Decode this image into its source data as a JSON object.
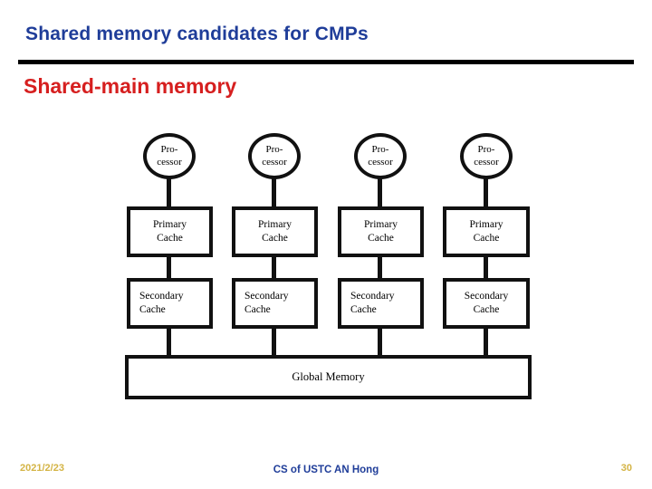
{
  "slide": {
    "title": "Shared memory candidates for CMPs",
    "subtitle": "Shared-main memory",
    "rule_color": "#000000",
    "title_color": "#1f3d99",
    "subtitle_color": "#d61f1f",
    "background": "#ffffff"
  },
  "diagram": {
    "type": "block-diagram",
    "line_color": "#111111",
    "columns": [
      {
        "processor": {
          "line1": "Pro-",
          "line2": "cessor"
        },
        "primary_cache": {
          "line1": "Primary",
          "line2": "Cache",
          "align": "center"
        },
        "secondary_cache": {
          "line1": "Secondary",
          "line2": "Cache",
          "align": "left"
        }
      },
      {
        "processor": {
          "line1": "Pro-",
          "line2": "cessor"
        },
        "primary_cache": {
          "line1": "Primary",
          "line2": "Cache",
          "align": "center"
        },
        "secondary_cache": {
          "line1": "Secondary",
          "line2": "Cache",
          "align": "left"
        }
      },
      {
        "processor": {
          "line1": "Pro-",
          "line2": "cessor"
        },
        "primary_cache": {
          "line1": "Primary",
          "line2": "Cache",
          "align": "center"
        },
        "secondary_cache": {
          "line1": "Secondary",
          "line2": "Cache",
          "align": "left"
        }
      },
      {
        "processor": {
          "line1": "Pro-",
          "line2": "cessor"
        },
        "primary_cache": {
          "line1": "Primary",
          "line2": "Cache",
          "align": "center"
        },
        "secondary_cache": {
          "line1": "Secondary",
          "line2": "Cache",
          "align": "center"
        }
      }
    ],
    "global_memory": {
      "label": "Global Memory"
    }
  },
  "footer": {
    "date": "2021/2/23",
    "center": "CS of USTC AN Hong",
    "page_number": "30",
    "date_color": "#d4b445",
    "center_color": "#1f3d99"
  }
}
